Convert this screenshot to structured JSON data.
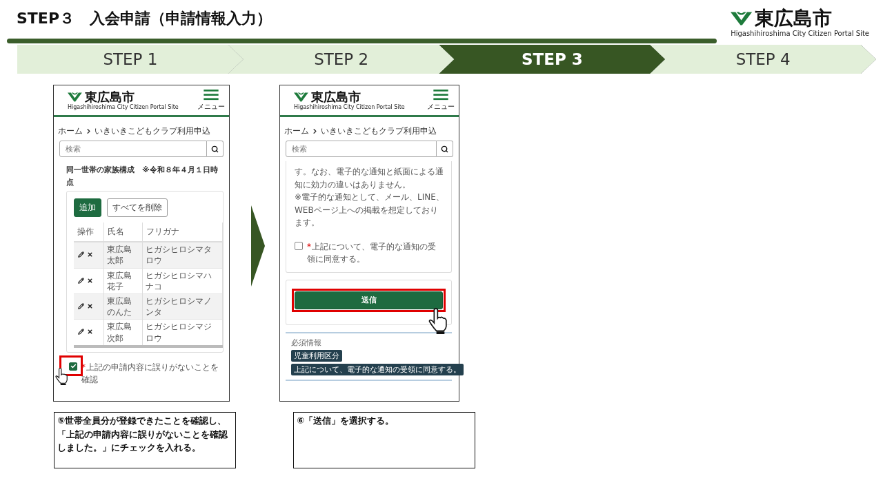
{
  "title": "STEP３　入会申請（申請情報入力）",
  "logo": {
    "name": "東広島市",
    "subtitle": "Higashihiroshima City Citizen Portal Site"
  },
  "steps": [
    {
      "label": "STEP 1",
      "selected": false
    },
    {
      "label": "STEP 2",
      "selected": false
    },
    {
      "label": "STEP 3",
      "selected": true
    },
    {
      "label": "STEP 4",
      "selected": false
    }
  ],
  "screens": [
    {
      "kind": "family",
      "logo_name": "東広島市",
      "logo_subtitle": "Higashihiroshima City Citizen Portal Site",
      "menu_label": "メニュー",
      "breadcrumb": [
        "ホーム",
        "いきいきこどもクラブ利用申込"
      ],
      "search_placeholder": "検索",
      "section_title": "同一世帯の家族構成　※令和８年４月１日時点",
      "add_label": "追加",
      "delete_all_label": "すべてを削除",
      "columns": [
        "操作",
        "氏名",
        "フリガナ"
      ],
      "rows": [
        {
          "name": "東広島太郎",
          "kana": "ヒガシヒロシマタロウ"
        },
        {
          "name": "東広島花子",
          "kana": "ヒガシヒロシマハナコ"
        },
        {
          "name": "東広島のんた",
          "kana": "ヒガシヒロシマノンタ"
        },
        {
          "name": "東広島次郎",
          "kana": "ヒガシヒロシマジロウ"
        }
      ],
      "checkbox": {
        "required_mark": "*",
        "label": "上記の申請内容に誤りがないことを確認",
        "checked": true
      },
      "caption": "⑤世帯全員分が登録できたことを確認し、「上記の申請内容に誤りがないことを確認しました。」にチェックを入れる。"
    },
    {
      "kind": "submit",
      "logo_name": "東広島市",
      "logo_subtitle": "Higashihiroshima City Citizen Portal Site",
      "menu_label": "メニュー",
      "breadcrumb": [
        "ホーム",
        "いきいきこどもクラブ利用申込"
      ],
      "search_placeholder": "検索",
      "notice": [
        "す。なお、電子的な通知と紙面による通知に効力の違いはありません。",
        "※電子的な通知として、メール、LINE、WEBページ上への掲載を想定しております。"
      ],
      "checkbox": {
        "required_mark": "*",
        "label": "上記について、電子的な通知の受領に同意する。",
        "checked": false
      },
      "submit_label": "送信",
      "required_title": "必須情報",
      "required_tags": [
        "児童利用区分",
        "上記について、電子的な通知の受領に同意する。"
      ],
      "caption": "⑥「送信」を選択する。"
    }
  ]
}
